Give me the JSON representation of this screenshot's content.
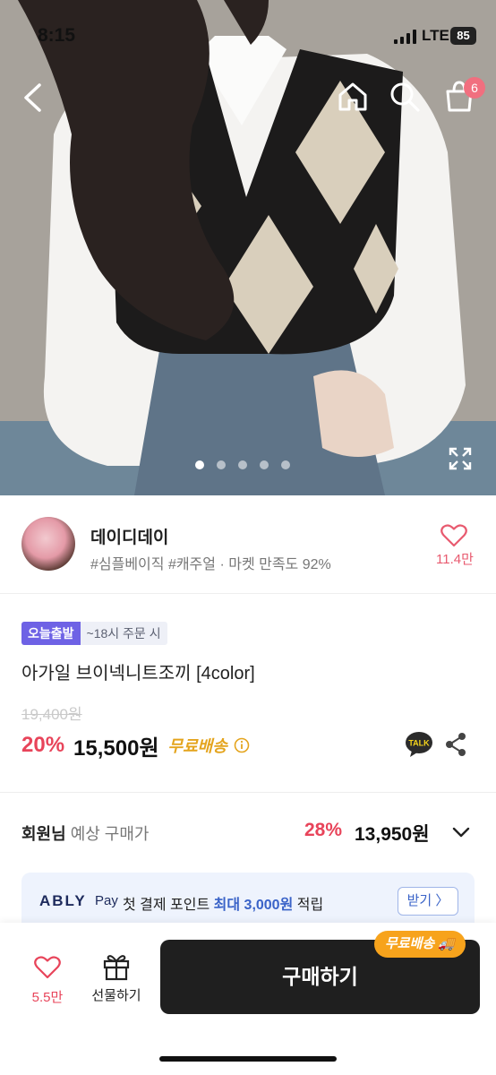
{
  "status_bar": {
    "time": "8:15",
    "network": "LTE",
    "battery": "85"
  },
  "header": {
    "cart_count": "6"
  },
  "gallery": {
    "image_count": 5,
    "active_index": 0
  },
  "seller": {
    "name": "데이디데이",
    "tags": "#심플베이직 #캐주얼 · 마켓 만족도 92%",
    "like_count": "11.4만"
  },
  "product": {
    "badge_delivery": "오늘출발",
    "badge_deadline": "~18시 주문 시",
    "title": "아가일 브이넥니트조끼 [4color]",
    "original_price": "19,400원",
    "discount": "20%",
    "price": "15,500원",
    "shipping": "무료배송"
  },
  "member": {
    "label_bold": "회원님",
    "label_rest": " 예상 구매가",
    "discount": "28%",
    "price": "13,950원"
  },
  "ably_pay": {
    "logo": "ABLY",
    "pay": "Pay",
    "text_pre": "첫 결제 포인트 ",
    "text_highlight": "최대 3,000원",
    "text_post": " 적립",
    "button": "받기 〉"
  },
  "bottom_bar": {
    "like_count": "5.5만",
    "gift_label": "선물하기",
    "buy_label": "구매하기",
    "buy_badge": "무료배송",
    "accent_color": "#e8445a"
  }
}
